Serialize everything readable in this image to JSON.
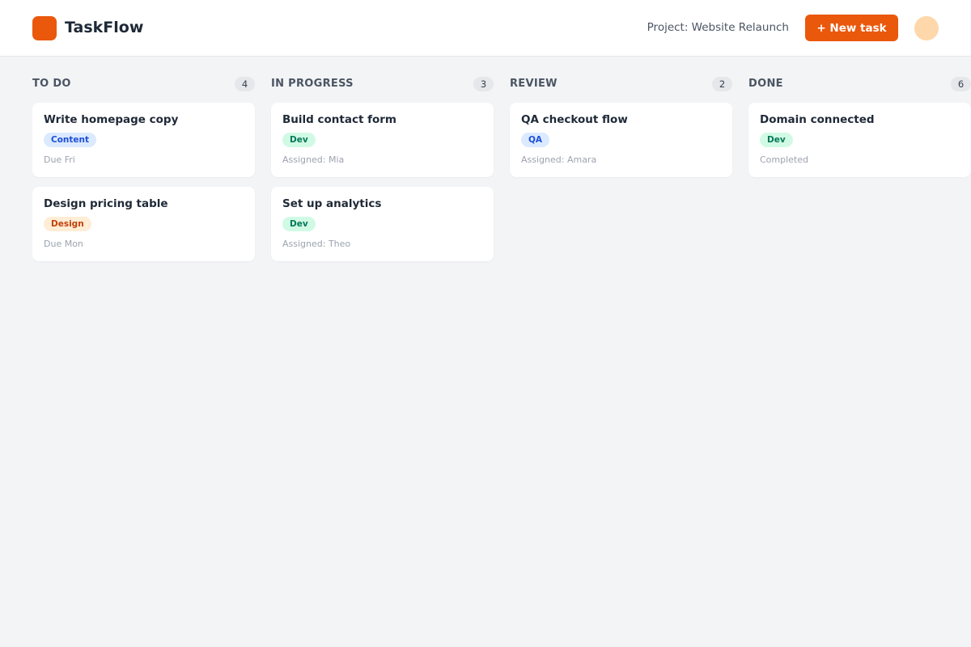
{
  "header": {
    "app_name": "TaskFlow",
    "project_label": "Project: Website Relaunch",
    "new_task_label": "+ New task"
  },
  "colors": {
    "brand": "#ea580c",
    "avatar": "#fed7aa",
    "board_bg": "#f3f4f6",
    "tags": {
      "Content": {
        "bg": "#dbeafe",
        "fg": "#1d4ed8"
      },
      "Design": {
        "bg": "#ffedd5",
        "fg": "#c2410c"
      },
      "Dev": {
        "bg": "#d1fae5",
        "fg": "#047857"
      },
      "QA": {
        "bg": "#dbeafe",
        "fg": "#1d4ed8"
      }
    }
  },
  "columns": [
    {
      "title": "TO DO",
      "count": "4",
      "cards": [
        {
          "title": "Write homepage copy",
          "tag": "Content",
          "meta": "Due Fri"
        },
        {
          "title": "Design pricing table",
          "tag": "Design",
          "meta": "Due Mon"
        }
      ]
    },
    {
      "title": "IN PROGRESS",
      "count": "3",
      "cards": [
        {
          "title": "Build contact form",
          "tag": "Dev",
          "meta": "Assigned: Mia"
        },
        {
          "title": "Set up analytics",
          "tag": "Dev",
          "meta": "Assigned: Theo"
        }
      ]
    },
    {
      "title": "REVIEW",
      "count": "2",
      "cards": [
        {
          "title": "QA checkout flow",
          "tag": "QA",
          "meta": "Assigned: Amara"
        }
      ]
    },
    {
      "title": "DONE",
      "count": "6",
      "cards": [
        {
          "title": "Domain connected",
          "tag": "Dev",
          "meta": "Completed"
        }
      ]
    }
  ]
}
